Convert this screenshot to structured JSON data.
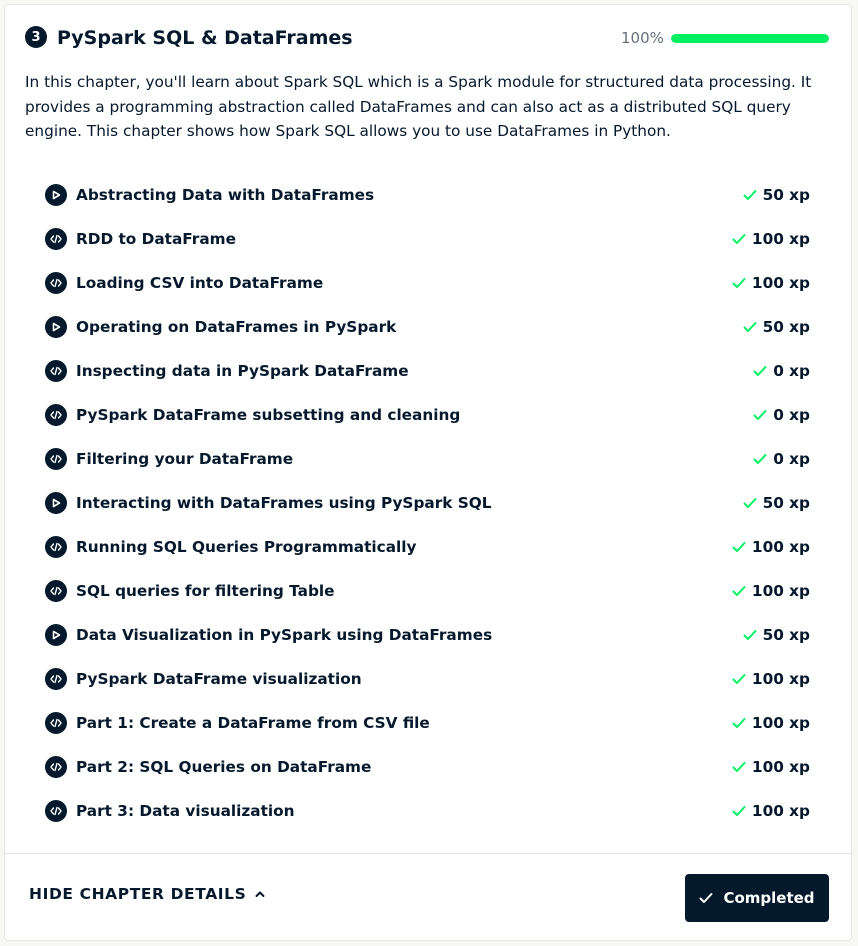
{
  "chapter": {
    "number": "3",
    "title": "PySpark SQL & DataFrames",
    "progress_label": "100%",
    "progress_value": 1.0,
    "description": "In this chapter, you'll learn about Spark SQL which is a Spark module for structured data processing. It provides a programming abstraction called DataFrames and can also act as a distributed SQL query engine. This chapter shows how Spark SQL allows you to use DataFrames in Python."
  },
  "colors": {
    "navy": "#05192d",
    "green": "#03ef62",
    "check_green": "#03ef62"
  },
  "exercises": [
    {
      "icon": "video-play-icon",
      "title": "Abstracting Data with DataFrames",
      "xp": "50 xp"
    },
    {
      "icon": "code-icon",
      "title": "RDD to DataFrame",
      "xp": "100 xp"
    },
    {
      "icon": "code-icon",
      "title": "Loading CSV into DataFrame",
      "xp": "100 xp"
    },
    {
      "icon": "video-play-icon",
      "title": "Operating on DataFrames in PySpark",
      "xp": "50 xp"
    },
    {
      "icon": "code-icon",
      "title": "Inspecting data in PySpark DataFrame",
      "xp": "0 xp"
    },
    {
      "icon": "code-icon",
      "title": "PySpark DataFrame subsetting and cleaning",
      "xp": "0 xp"
    },
    {
      "icon": "code-icon",
      "title": "Filtering your DataFrame",
      "xp": "0 xp"
    },
    {
      "icon": "video-play-icon",
      "title": "Interacting with DataFrames using PySpark SQL",
      "xp": "50 xp"
    },
    {
      "icon": "code-icon",
      "title": "Running SQL Queries Programmatically",
      "xp": "100 xp"
    },
    {
      "icon": "code-icon",
      "title": "SQL queries for filtering Table",
      "xp": "100 xp"
    },
    {
      "icon": "video-play-icon",
      "title": "Data Visualization in PySpark using DataFrames",
      "xp": "50 xp"
    },
    {
      "icon": "code-icon",
      "title": "PySpark DataFrame visualization",
      "xp": "100 xp"
    },
    {
      "icon": "code-icon",
      "title": "Part 1: Create a DataFrame from CSV file",
      "xp": "100 xp"
    },
    {
      "icon": "code-icon",
      "title": "Part 2: SQL Queries on DataFrame",
      "xp": "100 xp"
    },
    {
      "icon": "code-icon",
      "title": "Part 3: Data visualization",
      "xp": "100 xp"
    }
  ],
  "footer": {
    "hide_details_label": "HIDE CHAPTER DETAILS",
    "completed_label": "Completed"
  }
}
